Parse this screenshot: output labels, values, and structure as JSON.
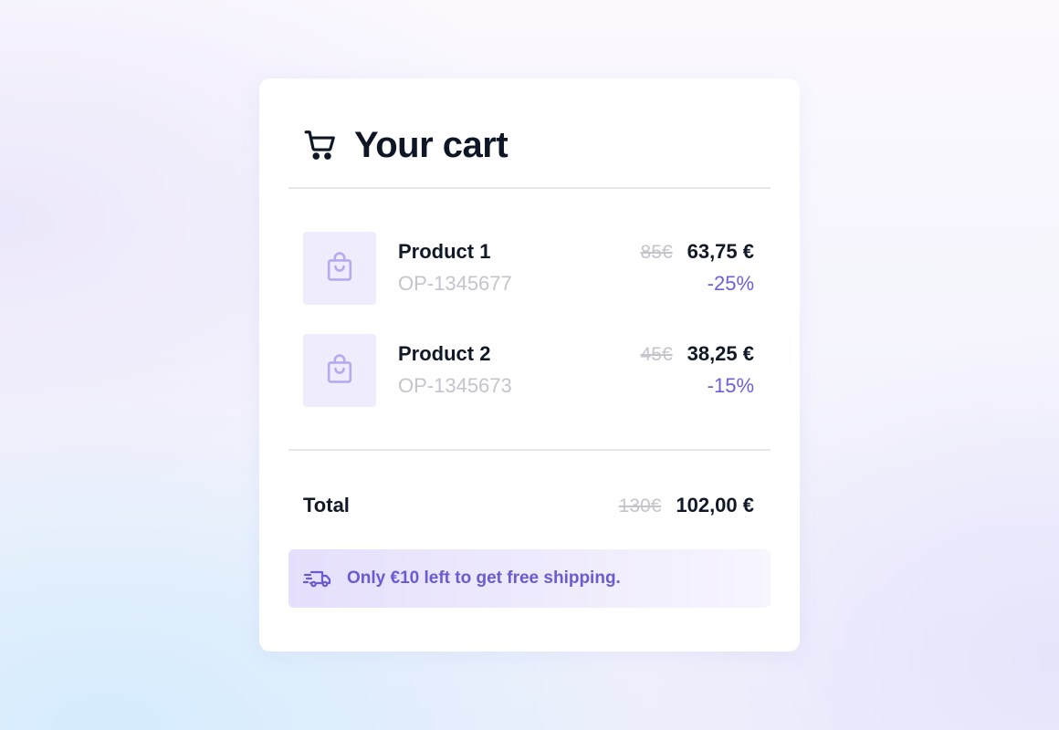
{
  "cart": {
    "title": "Your cart",
    "items": [
      {
        "name": "Product 1",
        "sku": "OP-1345677",
        "old_price": "85€",
        "price": "63,75 €",
        "discount": "-25%"
      },
      {
        "name": "Product 2",
        "sku": "OP-1345673",
        "old_price": "45€",
        "price": "38,25 €",
        "discount": "-15%"
      }
    ],
    "total": {
      "label": "Total",
      "old_price": "130€",
      "price": "102,00 €"
    },
    "shipping_message": "Only €10 left to get free shipping."
  },
  "icons": {
    "header": "shopping-cart-icon",
    "product": "shopping-bag-icon",
    "shipping": "fast-delivery-truck-icon"
  },
  "colors": {
    "accent": "#6d5fd5",
    "text": "#111827",
    "muted": "#c3c4cc",
    "thumb_bg": "#efecfd"
  }
}
